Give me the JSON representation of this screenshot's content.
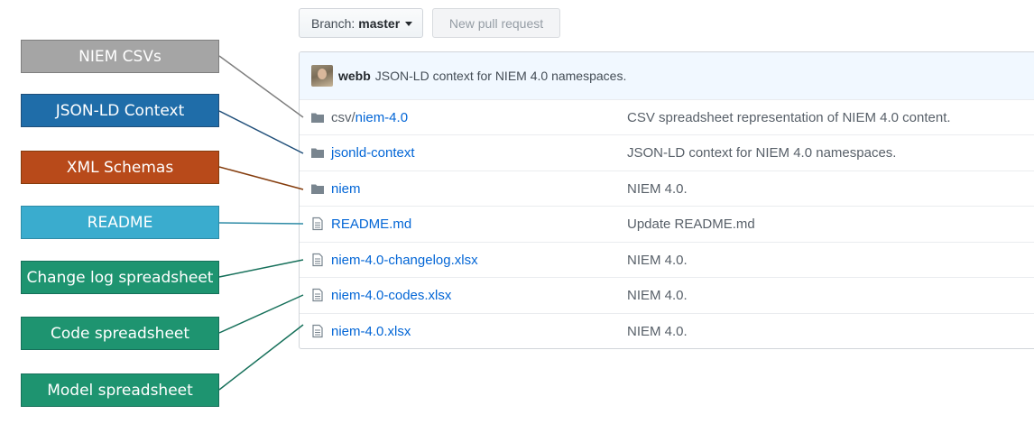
{
  "toolbar": {
    "branch_label": "Branch:",
    "branch_name": "master",
    "new_pull_request": "New pull request"
  },
  "commit": {
    "author": "webb",
    "message": "JSON-LD context for NIEM 4.0 namespaces."
  },
  "files": [
    {
      "type": "folder",
      "name_prefix": "csv/",
      "name": "niem-4.0",
      "message": "CSV spreadsheet representation of NIEM 4.0 content."
    },
    {
      "type": "folder",
      "name_prefix": "",
      "name": "jsonld-context",
      "message": "JSON-LD context for NIEM 4.0 namespaces."
    },
    {
      "type": "folder",
      "name_prefix": "",
      "name": "niem",
      "message": "NIEM 4.0."
    },
    {
      "type": "file",
      "name_prefix": "",
      "name": "README.md",
      "message": "Update README.md"
    },
    {
      "type": "file",
      "name_prefix": "",
      "name": "niem-4.0-changelog.xlsx",
      "message": "NIEM 4.0."
    },
    {
      "type": "file",
      "name_prefix": "",
      "name": "niem-4.0-codes.xlsx",
      "message": "NIEM 4.0."
    },
    {
      "type": "file",
      "name_prefix": "",
      "name": "niem-4.0.xlsx",
      "message": "NIEM 4.0."
    }
  ],
  "annotations": [
    {
      "label": "NIEM CSVs",
      "color": "#a5a5a5",
      "line_color": "#7f7f7f"
    },
    {
      "label": "JSON-LD Context",
      "color": "#1f6da9",
      "line_color": "#1f4e79"
    },
    {
      "label": "XML Schemas",
      "color": "#b84a1a",
      "line_color": "#843c0c"
    },
    {
      "label": "README",
      "color": "#3aacce",
      "line_color": "#2e8ba6"
    },
    {
      "label": "Change log spreadsheet",
      "color": "#1e9470",
      "line_color": "#16705a"
    },
    {
      "label": "Code spreadsheet",
      "color": "#1e9470",
      "line_color": "#16705a"
    },
    {
      "label": "Model spreadsheet",
      "color": "#1e9470",
      "line_color": "#16705a"
    }
  ],
  "colors": {
    "link": "#0366d6",
    "commit_bar": "#f1f8ff",
    "icon": "#79858f"
  }
}
